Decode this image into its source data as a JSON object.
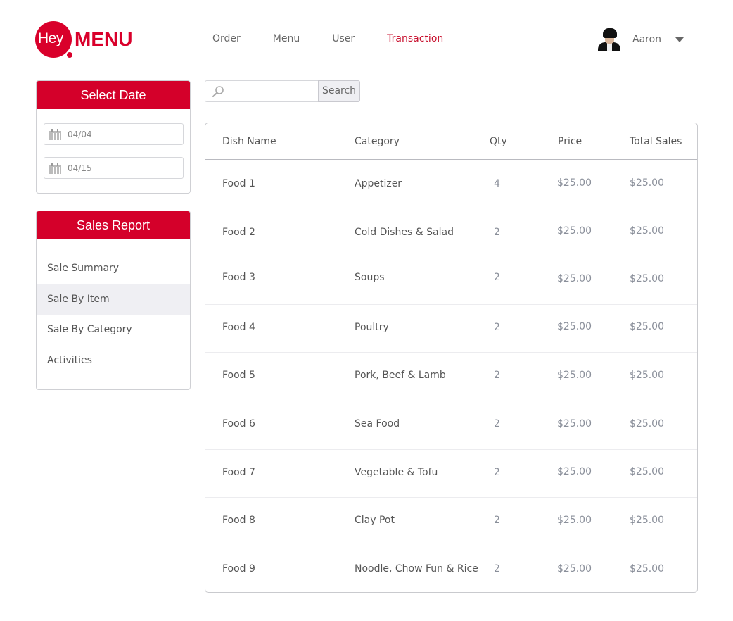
{
  "logo": {
    "hey": "Hey",
    "menu": "MENU"
  },
  "nav": {
    "items": [
      {
        "label": "Order",
        "active": false
      },
      {
        "label": "Menu",
        "active": false
      },
      {
        "label": "User",
        "active": false
      },
      {
        "label": "Transaction",
        "active": true
      }
    ]
  },
  "user": {
    "name": "Aaron",
    "avatar_icon": "user-photo",
    "menu_icon": "caret-down-icon"
  },
  "colors": {
    "brand": "#d4002a",
    "active_nav": "#c8102e",
    "selected_item_bg": "#efeff3"
  },
  "date_panel": {
    "title": "Select Date",
    "from": "04/04",
    "to": "04/15",
    "icon": "calendar-icon"
  },
  "report_panel": {
    "title": "Sales Report",
    "items": [
      {
        "label": "Sale Summary",
        "active": false
      },
      {
        "label": "Sale By Item",
        "active": true
      },
      {
        "label": "Sale By Category",
        "active": false
      },
      {
        "label": "Activities",
        "active": false
      }
    ]
  },
  "search": {
    "value": "",
    "placeholder": "",
    "button_label": "Search",
    "icon": "search-icon"
  },
  "table": {
    "columns": [
      "Dish Name",
      "Category",
      "Qty",
      "Price",
      "Total Sales"
    ],
    "rows": [
      {
        "dish": "Food 1",
        "category": "Appetizer",
        "qty": "4",
        "price": "$25.00",
        "total": "$25.00"
      },
      {
        "dish": "Food 2",
        "category": "Cold Dishes & Salad",
        "qty": "2",
        "price": "$25.00",
        "total": "$25.00"
      },
      {
        "dish": "Food 3",
        "category": "Soups",
        "qty": "2",
        "price": "$25.00",
        "total": "$25.00"
      },
      {
        "dish": "Food 4",
        "category": "Poultry",
        "qty": "2",
        "price": "$25.00",
        "total": "$25.00"
      },
      {
        "dish": "Food 5",
        "category": "Pork, Beef & Lamb",
        "qty": "2",
        "price": "$25.00",
        "total": "$25.00"
      },
      {
        "dish": "Food 6",
        "category": "Sea Food",
        "qty": "2",
        "price": "$25.00",
        "total": "$25.00"
      },
      {
        "dish": "Food 7",
        "category": "Vegetable & Tofu",
        "qty": "2",
        "price": "$25.00",
        "total": "$25.00"
      },
      {
        "dish": "Food 8",
        "category": "Clay Pot",
        "qty": "2",
        "price": "$25.00",
        "total": "$25.00"
      },
      {
        "dish": "Food 9",
        "category": "Noodle, Chow Fun & Rice",
        "qty": "2",
        "price": "$25.00",
        "total": "$25.00"
      }
    ]
  }
}
